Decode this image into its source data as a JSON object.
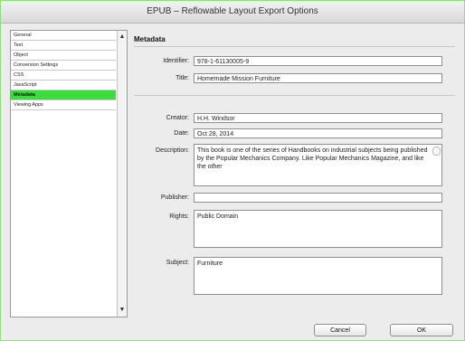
{
  "window": {
    "title": "EPUB – Reflowable Layout Export Options"
  },
  "sidebar": {
    "items": [
      {
        "label": "General",
        "selected": false
      },
      {
        "label": "Text",
        "selected": false
      },
      {
        "label": "Object",
        "selected": false
      },
      {
        "label": "Conversion Settings",
        "selected": false
      },
      {
        "label": "CSS",
        "selected": false
      },
      {
        "label": "JavaScript",
        "selected": false
      },
      {
        "label": "Metadata",
        "selected": true
      },
      {
        "label": "Viewing Apps",
        "selected": false
      }
    ]
  },
  "metadata": {
    "section_title": "Metadata",
    "identifier": {
      "label": "Identifier:",
      "value": "978-1-61130005-9"
    },
    "title": {
      "label": "Title:",
      "value": "Homemade Mission Furniture"
    },
    "creator": {
      "label": "Creator:",
      "value": "H.H. Windsor"
    },
    "date": {
      "label": "Date:",
      "value": "Oct 28, 2014"
    },
    "description": {
      "label": "Description:",
      "value": "This book is one of the series of Handbooks on industrial subjects being published by the Popular Mechanics Company. Like Popular Mechanics Magazine, and like the other"
    },
    "publisher": {
      "label": "Publisher:",
      "value": ""
    },
    "rights": {
      "label": "Rights:",
      "value": "Public Domain"
    },
    "subject": {
      "label": "Subject:",
      "value": "Furniture"
    }
  },
  "buttons": {
    "cancel": "Cancel",
    "ok": "OK"
  },
  "colors": {
    "selection": "#3ddc3d",
    "frame": "#8ee07a"
  }
}
